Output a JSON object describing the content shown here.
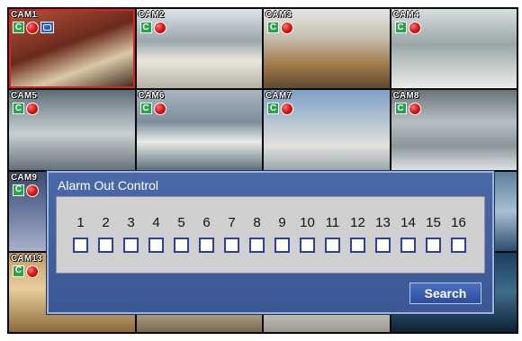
{
  "cameras": [
    {
      "label": "CAM1",
      "scene": "s1",
      "selected": true,
      "icons": [
        "c-icon",
        "record-icon",
        "network-icon"
      ]
    },
    {
      "label": "CAM2",
      "scene": "s2",
      "icons": [
        "c-icon",
        "record-icon"
      ]
    },
    {
      "label": "CAM3",
      "scene": "s3",
      "icons": [
        "c-icon",
        "record-icon"
      ]
    },
    {
      "label": "CAM4",
      "scene": "s4",
      "icons": [
        "c-icon",
        "record-icon"
      ]
    },
    {
      "label": "CAM5",
      "scene": "s5",
      "icons": [
        "c-icon",
        "record-icon"
      ]
    },
    {
      "label": "CAM6",
      "scene": "s6",
      "icons": [
        "c-icon",
        "record-icon"
      ]
    },
    {
      "label": "CAM7",
      "scene": "s7",
      "icons": [
        "c-icon",
        "record-icon"
      ]
    },
    {
      "label": "CAM8",
      "scene": "s8",
      "icons": [
        "c-icon",
        "record-icon"
      ]
    },
    {
      "label": "CAM9",
      "scene": "s9",
      "icons": [
        "c-icon",
        "record-icon"
      ]
    },
    {
      "label": "",
      "scene": "s10",
      "icons": []
    },
    {
      "label": "",
      "scene": "s11",
      "icons": []
    },
    {
      "label": "",
      "scene": "s12",
      "icons": []
    },
    {
      "label": "CAM13",
      "scene": "s13",
      "icons": [
        "c-icon",
        "record-icon"
      ]
    },
    {
      "label": "",
      "scene": "s14",
      "icons": []
    },
    {
      "label": "",
      "scene": "s15",
      "icons": []
    },
    {
      "label": "",
      "scene": "s16",
      "icons": []
    }
  ],
  "camera_icon_glyph": "C",
  "dialog": {
    "title": "Alarm Out Control",
    "channels": [
      "1",
      "2",
      "3",
      "4",
      "5",
      "6",
      "7",
      "8",
      "9",
      "10",
      "11",
      "12",
      "13",
      "14",
      "15",
      "16"
    ],
    "checked": [
      false,
      false,
      false,
      false,
      false,
      false,
      false,
      false,
      false,
      false,
      false,
      false,
      false,
      false,
      false,
      false
    ],
    "search_label": "Search"
  },
  "colors": {
    "dialog_bg": "#3a5895",
    "panel_bg": "#cfd0cf",
    "checkbox_border": "#2b3fa0",
    "record_red": "#e01a1a",
    "camera_icon_green": "#27a54a"
  }
}
